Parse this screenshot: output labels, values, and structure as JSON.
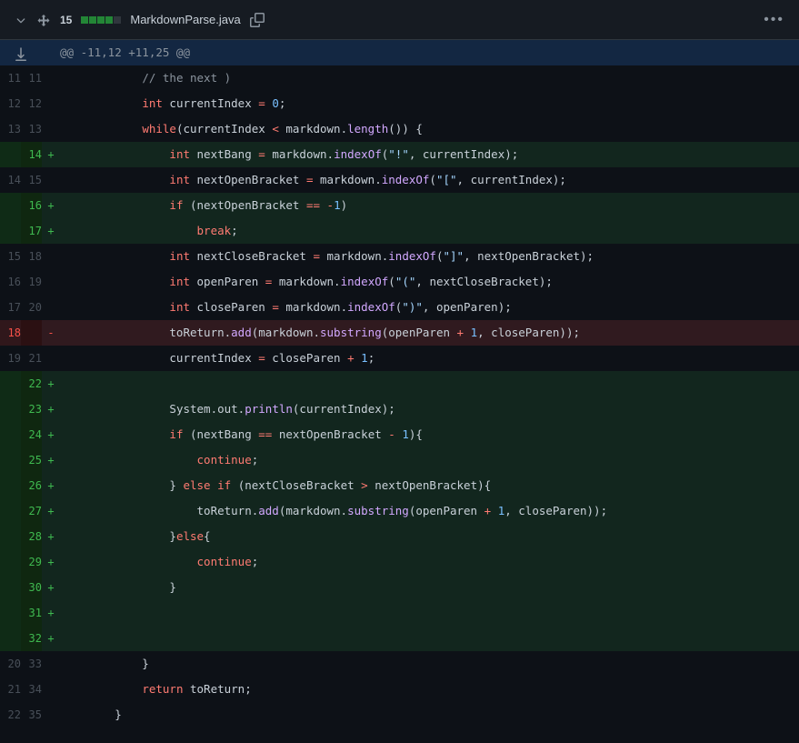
{
  "header": {
    "diff_count": "15",
    "filename": "MarkdownParse.java"
  },
  "hunk": "@@ -11,12 +11,25 @@",
  "lines": [
    {
      "type": "context",
      "l": "11",
      "r": "11",
      "m": " ",
      "tokens": [
        [
          "p",
          "            "
        ],
        [
          "c",
          "// the next )"
        ]
      ]
    },
    {
      "type": "context",
      "l": "12",
      "r": "12",
      "m": " ",
      "tokens": [
        [
          "p",
          "            "
        ],
        [
          "t",
          "int"
        ],
        [
          "p",
          " currentIndex "
        ],
        [
          "o",
          "="
        ],
        [
          "p",
          " "
        ],
        [
          "n",
          "0"
        ],
        [
          "p",
          ";"
        ]
      ]
    },
    {
      "type": "context",
      "l": "13",
      "r": "13",
      "m": " ",
      "tokens": [
        [
          "p",
          "            "
        ],
        [
          "k",
          "while"
        ],
        [
          "p",
          "(currentIndex "
        ],
        [
          "o",
          "<"
        ],
        [
          "p",
          " markdown."
        ],
        [
          "f",
          "length"
        ],
        [
          "p",
          "()) {"
        ]
      ]
    },
    {
      "type": "add",
      "l": "",
      "r": "14",
      "m": "+",
      "tokens": [
        [
          "p",
          "                "
        ],
        [
          "t",
          "int"
        ],
        [
          "p",
          " nextBang "
        ],
        [
          "o",
          "="
        ],
        [
          "p",
          " markdown."
        ],
        [
          "f",
          "indexOf"
        ],
        [
          "p",
          "("
        ],
        [
          "s",
          "\"!\""
        ],
        [
          "p",
          ", currentIndex);"
        ]
      ]
    },
    {
      "type": "context",
      "l": "14",
      "r": "15",
      "m": " ",
      "tokens": [
        [
          "p",
          "                "
        ],
        [
          "t",
          "int"
        ],
        [
          "p",
          " nextOpenBracket "
        ],
        [
          "o",
          "="
        ],
        [
          "p",
          " markdown."
        ],
        [
          "f",
          "indexOf"
        ],
        [
          "p",
          "("
        ],
        [
          "s",
          "\"[\""
        ],
        [
          "p",
          ", currentIndex);"
        ]
      ]
    },
    {
      "type": "add",
      "l": "",
      "r": "16",
      "m": "+",
      "tokens": [
        [
          "p",
          "                "
        ],
        [
          "k",
          "if"
        ],
        [
          "p",
          " (nextOpenBracket "
        ],
        [
          "o",
          "=="
        ],
        [
          "p",
          " "
        ],
        [
          "o",
          "-"
        ],
        [
          "n",
          "1"
        ],
        [
          "p",
          ")"
        ]
      ]
    },
    {
      "type": "add",
      "l": "",
      "r": "17",
      "m": "+",
      "tokens": [
        [
          "p",
          "                    "
        ],
        [
          "k",
          "break"
        ],
        [
          "p",
          ";"
        ]
      ]
    },
    {
      "type": "context",
      "l": "15",
      "r": "18",
      "m": " ",
      "tokens": [
        [
          "p",
          "                "
        ],
        [
          "t",
          "int"
        ],
        [
          "p",
          " nextCloseBracket "
        ],
        [
          "o",
          "="
        ],
        [
          "p",
          " markdown."
        ],
        [
          "f",
          "indexOf"
        ],
        [
          "p",
          "("
        ],
        [
          "s",
          "\"]\""
        ],
        [
          "p",
          ", nextOpenBracket);"
        ]
      ]
    },
    {
      "type": "context",
      "l": "16",
      "r": "19",
      "m": " ",
      "tokens": [
        [
          "p",
          "                "
        ],
        [
          "t",
          "int"
        ],
        [
          "p",
          " openParen "
        ],
        [
          "o",
          "="
        ],
        [
          "p",
          " markdown."
        ],
        [
          "f",
          "indexOf"
        ],
        [
          "p",
          "("
        ],
        [
          "s",
          "\"(\""
        ],
        [
          "p",
          ", nextCloseBracket);"
        ]
      ]
    },
    {
      "type": "context",
      "l": "17",
      "r": "20",
      "m": " ",
      "tokens": [
        [
          "p",
          "                "
        ],
        [
          "t",
          "int"
        ],
        [
          "p",
          " closeParen "
        ],
        [
          "o",
          "="
        ],
        [
          "p",
          " markdown."
        ],
        [
          "f",
          "indexOf"
        ],
        [
          "p",
          "("
        ],
        [
          "s",
          "\")\""
        ],
        [
          "p",
          ", openParen);"
        ]
      ]
    },
    {
      "type": "del",
      "l": "18",
      "r": "",
      "m": "-",
      "tokens": [
        [
          "p",
          "                toReturn."
        ],
        [
          "f",
          "add"
        ],
        [
          "p",
          "(markdown."
        ],
        [
          "f",
          "substring"
        ],
        [
          "p",
          "(openParen "
        ],
        [
          "o",
          "+"
        ],
        [
          "p",
          " "
        ],
        [
          "n",
          "1"
        ],
        [
          "p",
          ", closeParen));"
        ]
      ]
    },
    {
      "type": "context",
      "l": "19",
      "r": "21",
      "m": " ",
      "tokens": [
        [
          "p",
          "                currentIndex "
        ],
        [
          "o",
          "="
        ],
        [
          "p",
          " closeParen "
        ],
        [
          "o",
          "+"
        ],
        [
          "p",
          " "
        ],
        [
          "n",
          "1"
        ],
        [
          "p",
          ";"
        ]
      ]
    },
    {
      "type": "add",
      "l": "",
      "r": "22",
      "m": "+",
      "tokens": [
        [
          "p",
          ""
        ]
      ]
    },
    {
      "type": "add",
      "l": "",
      "r": "23",
      "m": "+",
      "tokens": [
        [
          "p",
          "                "
        ],
        [
          "p",
          "System"
        ],
        [
          "p",
          ".out."
        ],
        [
          "f",
          "println"
        ],
        [
          "p",
          "(currentIndex);"
        ]
      ]
    },
    {
      "type": "add",
      "l": "",
      "r": "24",
      "m": "+",
      "tokens": [
        [
          "p",
          "                "
        ],
        [
          "k",
          "if"
        ],
        [
          "p",
          " (nextBang "
        ],
        [
          "o",
          "=="
        ],
        [
          "p",
          " nextOpenBracket "
        ],
        [
          "o",
          "-"
        ],
        [
          "p",
          " "
        ],
        [
          "n",
          "1"
        ],
        [
          "p",
          "){"
        ]
      ]
    },
    {
      "type": "add",
      "l": "",
      "r": "25",
      "m": "+",
      "tokens": [
        [
          "p",
          "                    "
        ],
        [
          "k",
          "continue"
        ],
        [
          "p",
          ";"
        ]
      ]
    },
    {
      "type": "add",
      "l": "",
      "r": "26",
      "m": "+",
      "tokens": [
        [
          "p",
          "                } "
        ],
        [
          "k",
          "else"
        ],
        [
          "p",
          " "
        ],
        [
          "k",
          "if"
        ],
        [
          "p",
          " (nextCloseBracket "
        ],
        [
          "o",
          ">"
        ],
        [
          "p",
          " nextOpenBracket){"
        ]
      ]
    },
    {
      "type": "add",
      "l": "",
      "r": "27",
      "m": "+",
      "tokens": [
        [
          "p",
          "                    toReturn."
        ],
        [
          "f",
          "add"
        ],
        [
          "p",
          "(markdown."
        ],
        [
          "f",
          "substring"
        ],
        [
          "p",
          "(openParen "
        ],
        [
          "o",
          "+"
        ],
        [
          "p",
          " "
        ],
        [
          "n",
          "1"
        ],
        [
          "p",
          ", closeParen));"
        ]
      ]
    },
    {
      "type": "add",
      "l": "",
      "r": "28",
      "m": "+",
      "tokens": [
        [
          "p",
          "                }"
        ],
        [
          "k",
          "else"
        ],
        [
          "p",
          "{"
        ]
      ]
    },
    {
      "type": "add",
      "l": "",
      "r": "29",
      "m": "+",
      "tokens": [
        [
          "p",
          "                    "
        ],
        [
          "k",
          "continue"
        ],
        [
          "p",
          ";"
        ]
      ]
    },
    {
      "type": "add",
      "l": "",
      "r": "30",
      "m": "+",
      "tokens": [
        [
          "p",
          "                }"
        ]
      ]
    },
    {
      "type": "add",
      "l": "",
      "r": "31",
      "m": "+",
      "tokens": [
        [
          "p",
          ""
        ]
      ]
    },
    {
      "type": "add",
      "l": "",
      "r": "32",
      "m": "+",
      "tokens": [
        [
          "p",
          ""
        ]
      ]
    },
    {
      "type": "context",
      "l": "20",
      "r": "33",
      "m": " ",
      "tokens": [
        [
          "p",
          "            }"
        ]
      ]
    },
    {
      "type": "context",
      "l": "21",
      "r": "34",
      "m": " ",
      "tokens": [
        [
          "p",
          "            "
        ],
        [
          "k",
          "return"
        ],
        [
          "p",
          " toReturn;"
        ]
      ]
    },
    {
      "type": "context",
      "l": "22",
      "r": "35",
      "m": " ",
      "tokens": [
        [
          "p",
          "        }"
        ]
      ]
    }
  ]
}
